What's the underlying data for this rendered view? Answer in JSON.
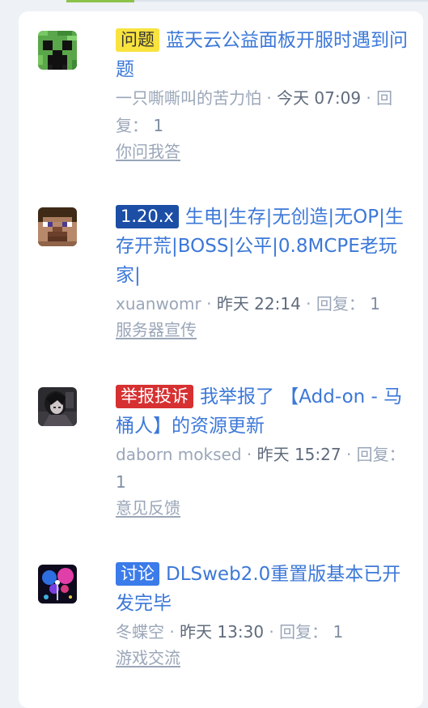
{
  "threads": [
    {
      "tag": "问题",
      "title": "蓝天云公益面板开服时遇到问题",
      "author": "一只嘶嘶叫的苦力怕",
      "time": "今天 07:09",
      "reply_label": "回复：",
      "reply_count": "1",
      "category": "你问我答",
      "avatar_icon": "creeper-avatar-icon",
      "tag_color": "#f9e33f"
    },
    {
      "tag": "1.20.x",
      "title": "生电|生存|无创造|无OP|生存开荒|BOSS|公平|0.8MCPE老玩家|",
      "author": "xuanwomr",
      "time": "昨天 22:14",
      "reply_label": "回复：",
      "reply_count": "1",
      "category": "服务器宣传",
      "avatar_icon": "steve-avatar-icon",
      "tag_color": "#1c4ea6"
    },
    {
      "tag": "举报投诉",
      "title": "我举报了 【Add-on - 马桶人】的资源更新",
      "author": "daborn moksed",
      "time": "昨天 15:27",
      "reply_label": "回复：",
      "reply_count": "1",
      "category": "意见反馈",
      "avatar_icon": "dark-character-avatar-icon",
      "tag_color": "#d63031"
    },
    {
      "tag": "讨论",
      "title": "DLSweb2.0重置版基本已开发完毕",
      "author": "冬蝶空",
      "time": "昨天 13:30",
      "reply_label": "回复：",
      "reply_count": "1",
      "category": "游戏交流",
      "avatar_icon": "neon-butterfly-avatar-icon",
      "tag_color": "#3b7bea"
    }
  ]
}
